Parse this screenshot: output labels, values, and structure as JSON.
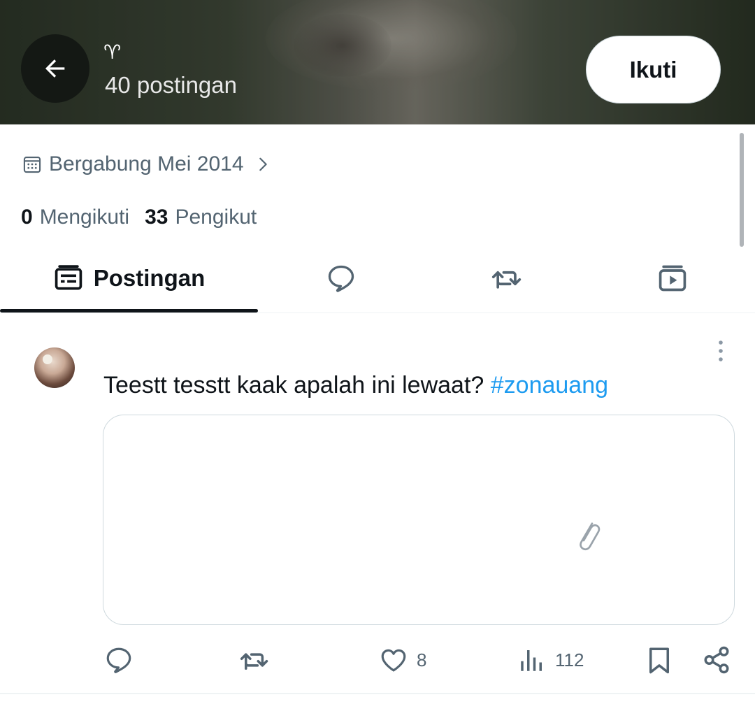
{
  "header": {
    "display_name": "♈",
    "posts_count": "40 postingan",
    "follow_label": "Ikuti"
  },
  "profile": {
    "joined": "Bergabung Mei 2014",
    "following_count": "0",
    "following_label": "Mengikuti",
    "followers_count": "33",
    "followers_label": "Pengikut"
  },
  "tabs": {
    "posts_label": "Postingan",
    "icons": [
      "posts-icon",
      "replies-icon",
      "reposts-icon",
      "media-icon"
    ]
  },
  "post": {
    "text": "Teestt tesstt kaak apalah ini lewaat? ",
    "hashtag": "#zonauang",
    "likes": "8",
    "views": "112"
  },
  "colors": {
    "link": "#1d9bf0",
    "secondary_text": "#536471",
    "primary_text": "#0f1419"
  }
}
